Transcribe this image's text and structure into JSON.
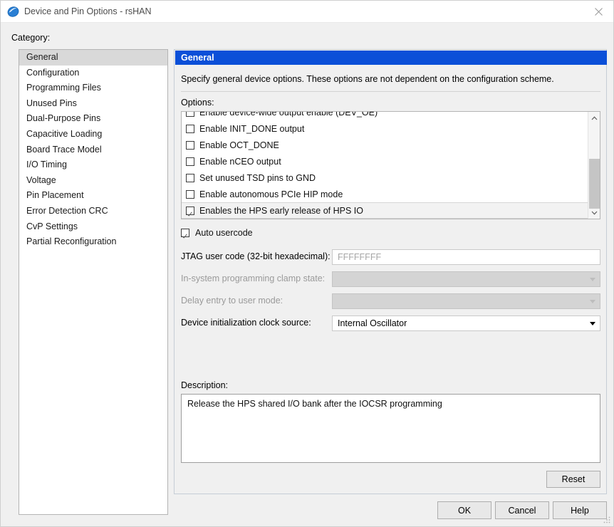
{
  "window": {
    "title": "Device and Pin Options - rsHAN",
    "icon": "globe-icon",
    "close_label": "close-icon"
  },
  "category": {
    "label": "Category:",
    "selected": "General",
    "items": [
      {
        "label": "General"
      },
      {
        "label": "Configuration"
      },
      {
        "label": "Programming Files"
      },
      {
        "label": "Unused Pins"
      },
      {
        "label": "Dual-Purpose Pins"
      },
      {
        "label": "Capacitive Loading"
      },
      {
        "label": "Board Trace Model"
      },
      {
        "label": "I/O Timing"
      },
      {
        "label": "Voltage"
      },
      {
        "label": "Pin Placement"
      },
      {
        "label": "Error Detection CRC"
      },
      {
        "label": "CvP Settings"
      },
      {
        "label": "Partial Reconfiguration"
      }
    ]
  },
  "panel": {
    "header": "General",
    "description": "Specify general device options. These options are not dependent on the configuration scheme.",
    "options_label": "Options:",
    "options": [
      {
        "label": "Enable device-wide output enable (DEV_OE)",
        "checked": false,
        "selected": false
      },
      {
        "label": "Enable INIT_DONE output",
        "checked": false,
        "selected": false
      },
      {
        "label": "Enable OCT_DONE",
        "checked": false,
        "selected": false
      },
      {
        "label": "Enable nCEO output",
        "checked": false,
        "selected": false
      },
      {
        "label": "Set unused TSD pins to GND",
        "checked": false,
        "selected": false
      },
      {
        "label": "Enable autonomous PCIe HIP mode",
        "checked": false,
        "selected": false
      },
      {
        "label": "Enables the HPS early release of HPS IO",
        "checked": true,
        "selected": true
      }
    ],
    "auto_usercode": {
      "label": "Auto usercode",
      "checked": true
    },
    "fields": [
      {
        "label": "JTAG user code (32-bit hexadecimal):",
        "type": "text",
        "value": "FFFFFFFF",
        "disabled": true
      },
      {
        "label": "In-system programming clamp state:",
        "type": "select",
        "value": "",
        "disabled": true
      },
      {
        "label": "Delay entry to user mode:",
        "type": "select",
        "value": "",
        "disabled": true
      },
      {
        "label": "Device initialization clock source:",
        "type": "select",
        "value": "Internal Oscillator",
        "disabled": false
      }
    ],
    "description_label": "Description:",
    "description_text": "Release the HPS shared I/O bank after the IOCSR programming",
    "reset_label": "Reset"
  },
  "footer": {
    "ok_label": "OK",
    "cancel_label": "Cancel",
    "help_label": "Help"
  },
  "colors": {
    "header_blue": "#0b4fd8",
    "window_bg": "#f0f0f0",
    "selection_gray": "#d9d9d9"
  }
}
